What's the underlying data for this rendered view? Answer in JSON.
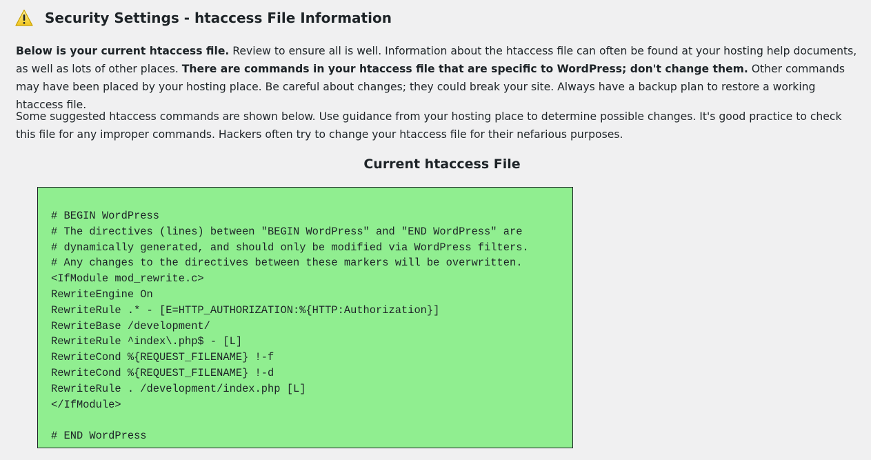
{
  "header": {
    "title": "Security Settings - htaccess File Information",
    "icon": "warning-icon",
    "icon_color": "#f0c41b"
  },
  "intro": {
    "bold1": "Below is your current htaccess file.",
    "text1": " Review to ensure all is well. Information about the htaccess file can often be found at your hosting help documents, as well as lots of other places. ",
    "bold2": "There are commands in your htaccess file that are specific to WordPress; don't change them.",
    "text2": " Other commands may have been placed by your hosting place. Be careful about changes; they could break your site. Always have a backup plan to restore a working htaccess file."
  },
  "suggest": {
    "text": "Some suggested htaccess commands are shown below. Use guidance from your hosting place to determine possible changes. It's good practice to check this file for any improper commands. Hackers often try to change your htaccess file for their nefarious purposes."
  },
  "section": {
    "title": "Current htaccess File"
  },
  "htaccess": {
    "background": "#90ee90",
    "lines": [
      "# BEGIN WordPress",
      "# The directives (lines) between \"BEGIN WordPress\" and \"END WordPress\" are",
      "# dynamically generated, and should only be modified via WordPress filters.",
      "# Any changes to the directives between these markers will be overwritten.",
      "<IfModule mod_rewrite.c>",
      "RewriteEngine On",
      "RewriteRule .* - [E=HTTP_AUTHORIZATION:%{HTTP:Authorization}]",
      "RewriteBase /development/",
      "RewriteRule ^index\\.php$ - [L]",
      "RewriteCond %{REQUEST_FILENAME} !-f",
      "RewriteCond %{REQUEST_FILENAME} !-d",
      "RewriteRule . /development/index.php [L]",
      "</IfModule>",
      "",
      "# END WordPress"
    ]
  }
}
